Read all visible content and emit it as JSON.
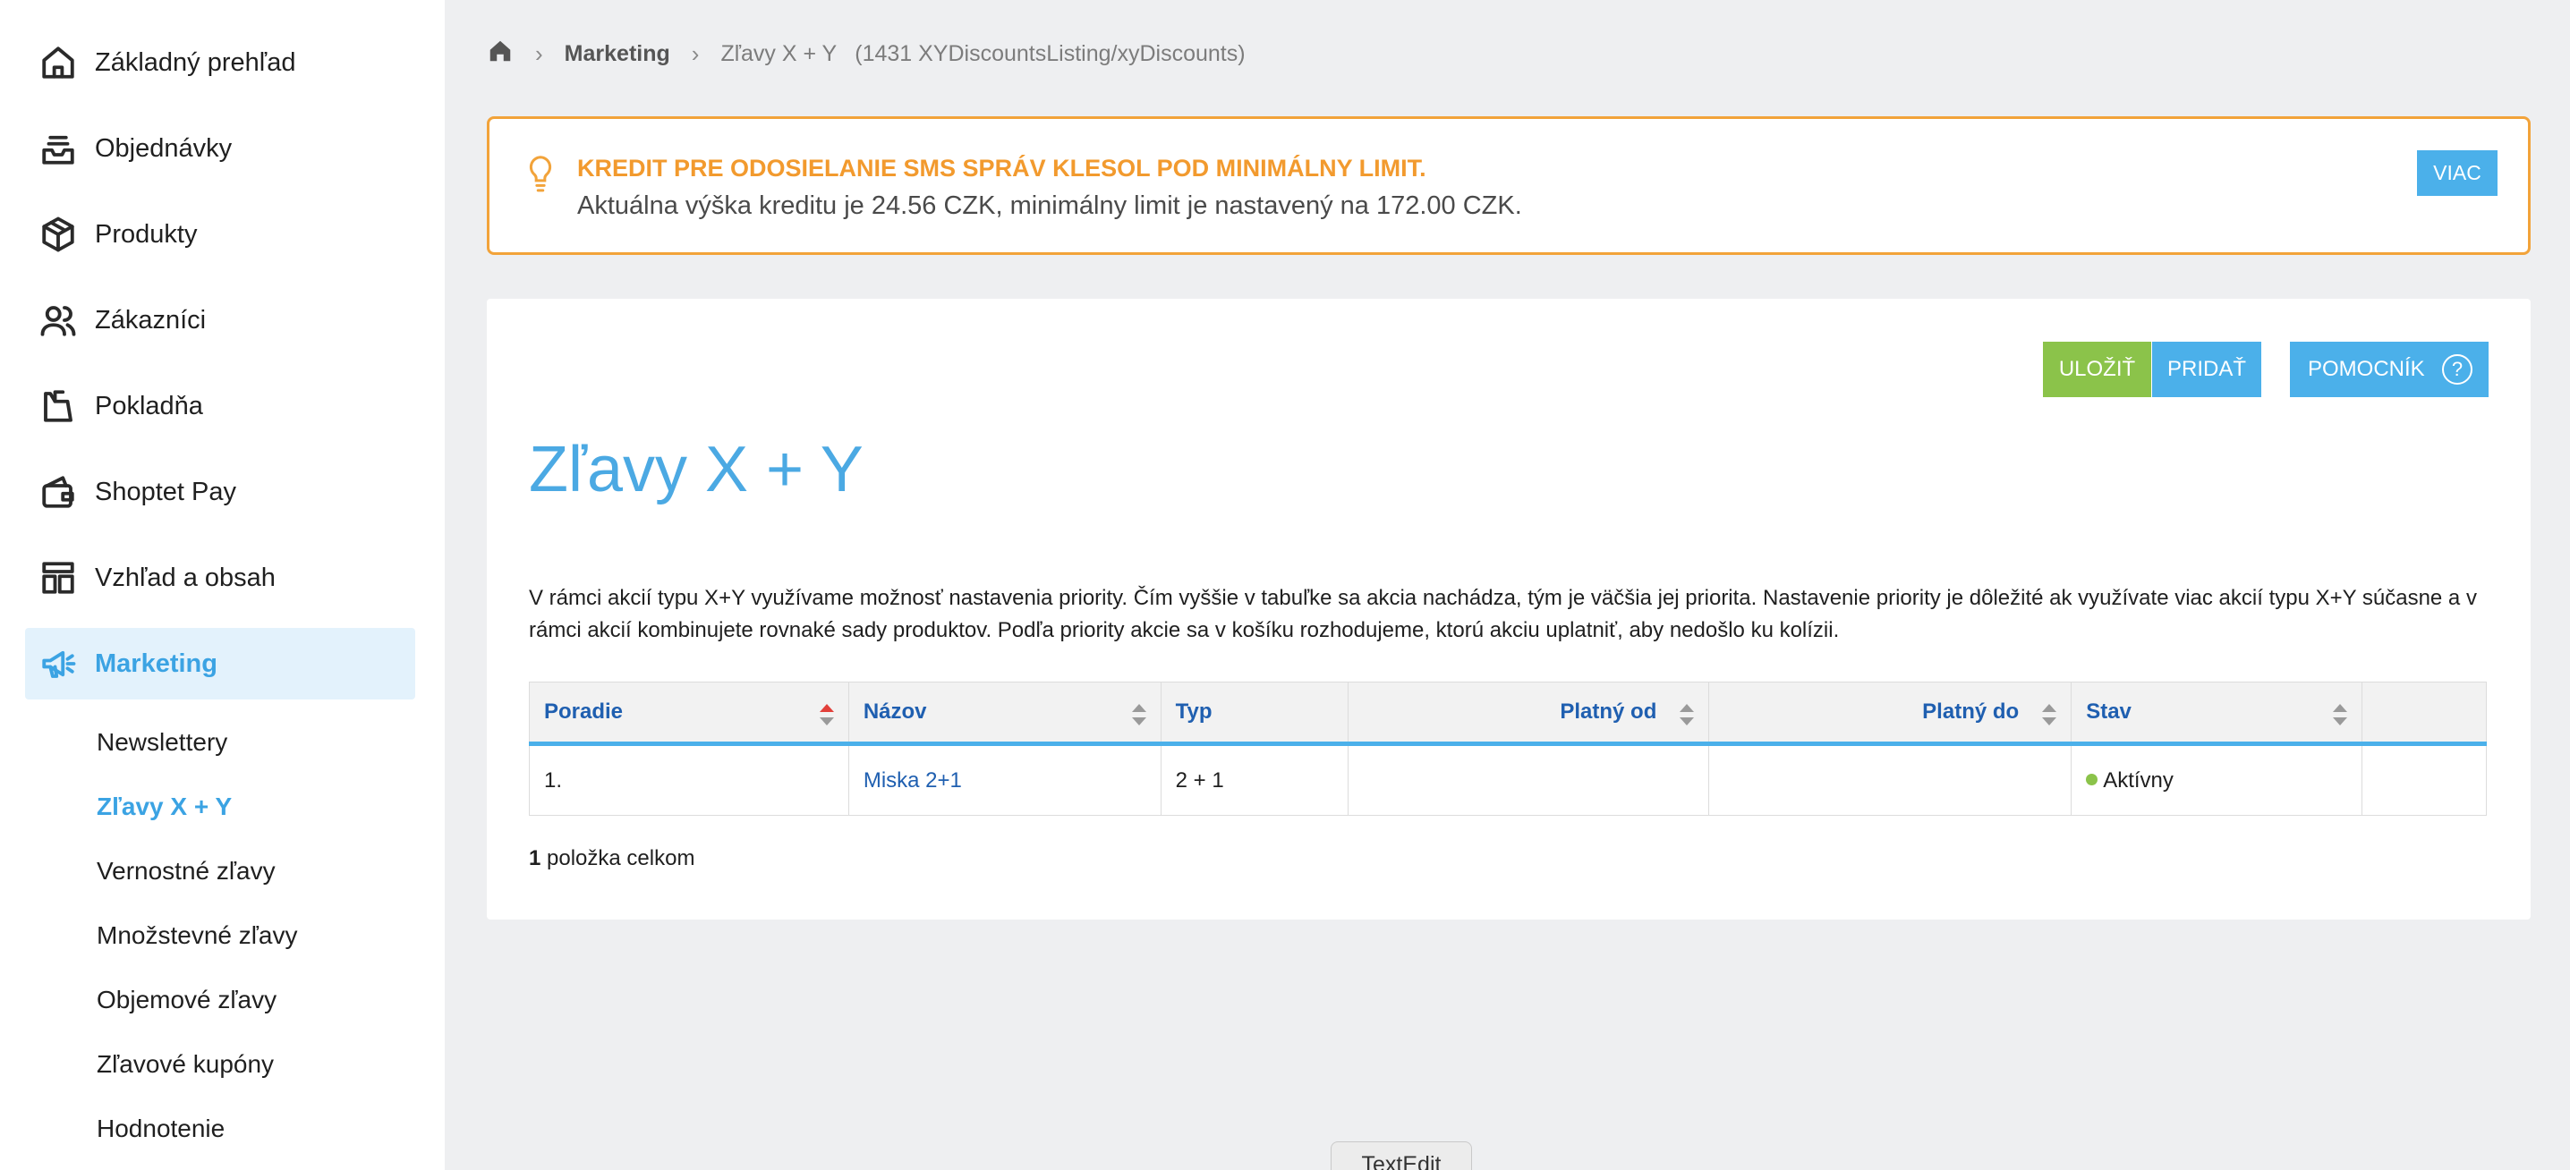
{
  "sidebar": {
    "items": [
      {
        "label": "Základný prehľad",
        "icon": "home-icon"
      },
      {
        "label": "Objednávky",
        "icon": "inbox-icon"
      },
      {
        "label": "Produkty",
        "icon": "box-icon"
      },
      {
        "label": "Zákazníci",
        "icon": "users-icon"
      },
      {
        "label": "Pokladňa",
        "icon": "register-icon"
      },
      {
        "label": "Shoptet Pay",
        "icon": "wallet-icon"
      },
      {
        "label": "Vzhľad a obsah",
        "icon": "layout-icon"
      },
      {
        "label": "Marketing",
        "icon": "megaphone-icon",
        "active": true
      }
    ],
    "subitems": [
      {
        "label": "Newslettery"
      },
      {
        "label": "Zľavy X + Y",
        "active": true
      },
      {
        "label": "Vernostné zľavy"
      },
      {
        "label": "Množstevné zľavy"
      },
      {
        "label": "Objemové zľavy"
      },
      {
        "label": "Zľavové kupóny"
      },
      {
        "label": "Hodnotenie"
      }
    ]
  },
  "breadcrumb": {
    "section": "Marketing",
    "current": "Zľavy X + Y",
    "code": "(1431 XYDiscountsListing/xyDiscounts)"
  },
  "alert": {
    "title": "KREDIT PRE ODOSIELANIE SMS SPRÁV KLESOL POD MINIMÁLNY LIMIT.",
    "text": "Aktuálna výška kreditu je 24.56 CZK, minimálny limit je nastavený na 172.00 CZK.",
    "button": "VIAC",
    "color": "#f29a2e"
  },
  "toolbar": {
    "save": "ULOŽIŤ",
    "add": "PRIDAŤ",
    "help": "POMOCNÍK",
    "help_icon": "?"
  },
  "page": {
    "title": "Zľavy X + Y",
    "description": "V rámci akcií typu X+Y využívame možnosť nastavenia priority. Čím vyššie v tabuľke sa akcia nachádza, tým je väčšia jej priorita. Nastavenie priority je dôležité ak využívate viac akcií typu X+Y súčasne a v rámci akcií kombinujete rovnaké sady produktov. Podľa priority akcie sa v košíku rozhodujeme, ktorú akciu uplatniť, aby nedošlo ku kolízii."
  },
  "table": {
    "headers": {
      "order": "Poradie",
      "name": "Názov",
      "type": "Typ",
      "valid_from": "Platný od",
      "valid_to": "Platný do",
      "status": "Stav"
    },
    "rows": [
      {
        "order": "1.",
        "name": "Miska 2+1",
        "type": "2 + 1",
        "valid_from": "",
        "valid_to": "",
        "status": "Aktívny"
      }
    ],
    "count_number": "1",
    "count_text": " položka celkom"
  },
  "dock": {
    "tooltip": "TextEdit"
  },
  "colors": {
    "accent": "#4bb0ea",
    "save": "#8bc34a",
    "warning": "#f2a33a"
  }
}
